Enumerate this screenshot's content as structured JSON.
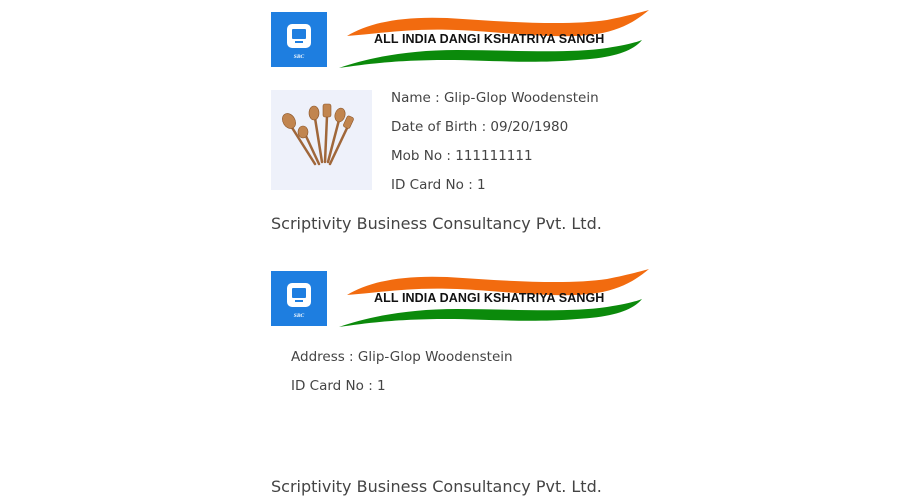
{
  "org": {
    "logo_text": "SBC",
    "title": "ALL INDIA DANGI KSHATRIYA SANGH",
    "colors": {
      "logo_blue": "#1e7ee0",
      "saffron": "#f26b0f",
      "green": "#0b8a0b"
    }
  },
  "front": {
    "photo_icon": "wooden-spoons-image",
    "name": "Name : Glip-Glop Woodenstein",
    "dob": "Date of Birth : 09/20/1980",
    "mobile": "Mob No : 111111111",
    "id_card": "ID Card No : 1",
    "company": "Scriptivity Business Consultancy Pvt. Ltd."
  },
  "back": {
    "address": "Address : Glip-Glop Woodenstein",
    "id_card": "ID Card No : 1",
    "company": "Scriptivity Business Consultancy Pvt. Ltd."
  }
}
